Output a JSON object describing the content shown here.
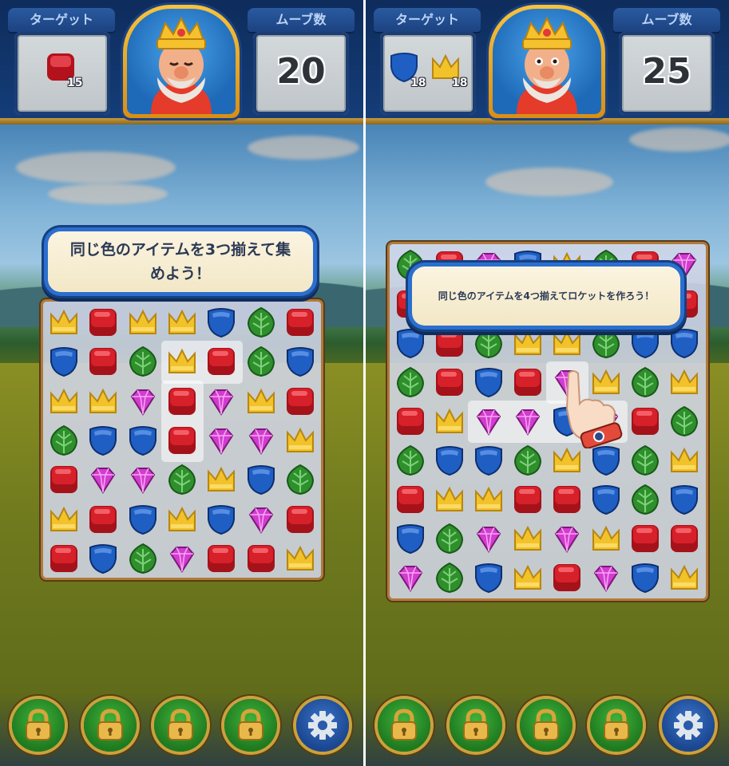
{
  "left": {
    "header": {
      "target_label": "ターゲット",
      "moves_label": "ムーブ数",
      "moves_value": "20"
    },
    "targets": [
      {
        "icon": "red-box-icon",
        "count": "15"
      }
    ],
    "tooltip": "同じ色のアイテムを3つ揃えて集めよう！",
    "board": [
      [
        "crown",
        "red",
        "crown",
        "crown",
        "blue",
        "green",
        "red"
      ],
      [
        "blue",
        "red",
        "green",
        "crown",
        "red",
        "green",
        "blue"
      ],
      [
        "crown",
        "crown",
        "pink",
        "red",
        "pink",
        "crown",
        "red"
      ],
      [
        "green",
        "blue",
        "blue",
        "red",
        "pink",
        "pink",
        "crown"
      ],
      [
        "red",
        "pink",
        "pink",
        "green",
        "crown",
        "blue",
        "green"
      ],
      [
        "crown",
        "red",
        "blue",
        "crown",
        "blue",
        "pink",
        "red"
      ],
      [
        "red",
        "blue",
        "green",
        "pink",
        "red",
        "red",
        "crown"
      ]
    ]
  },
  "right": {
    "header": {
      "target_label": "ターゲット",
      "moves_label": "ムーブ数",
      "moves_value": "25"
    },
    "targets": [
      {
        "icon": "blue-shield-icon",
        "count": "18"
      },
      {
        "icon": "yellow-crown-icon",
        "count": "18"
      }
    ],
    "tooltip": "同じ色のアイテムを4つ揃えてロケットを作ろう！",
    "board": [
      [
        "green",
        "red",
        "pink",
        "blue",
        "crown",
        "green",
        "red",
        "pink"
      ],
      [
        "red",
        "crown",
        "pink",
        "green",
        "blue",
        "blue",
        "red",
        "red"
      ],
      [
        "blue",
        "red",
        "green",
        "crown",
        "crown",
        "green",
        "blue",
        "blue"
      ],
      [
        "green",
        "red",
        "blue",
        "red",
        "pink",
        "crown",
        "green",
        "crown"
      ],
      [
        "red",
        "crown",
        "pink",
        "pink",
        "blue",
        "pink",
        "red",
        "green"
      ],
      [
        "green",
        "blue",
        "blue",
        "green",
        "crown",
        "blue",
        "green",
        "crown"
      ],
      [
        "red",
        "crown",
        "crown",
        "red",
        "red",
        "blue",
        "green",
        "blue"
      ],
      [
        "blue",
        "green",
        "pink",
        "crown",
        "pink",
        "crown",
        "red",
        "red"
      ],
      [
        "pink",
        "green",
        "blue",
        "crown",
        "red",
        "pink",
        "blue",
        "crown"
      ]
    ]
  },
  "bottom_buttons": [
    "lock-icon",
    "lock-icon",
    "lock-icon",
    "lock-icon",
    "gear-icon"
  ],
  "colors": {
    "red": "#d6202a",
    "blue": "#1f5fc4",
    "green": "#2f8f2c",
    "crown": "#f2c22a",
    "pink": "#d23ccf"
  }
}
